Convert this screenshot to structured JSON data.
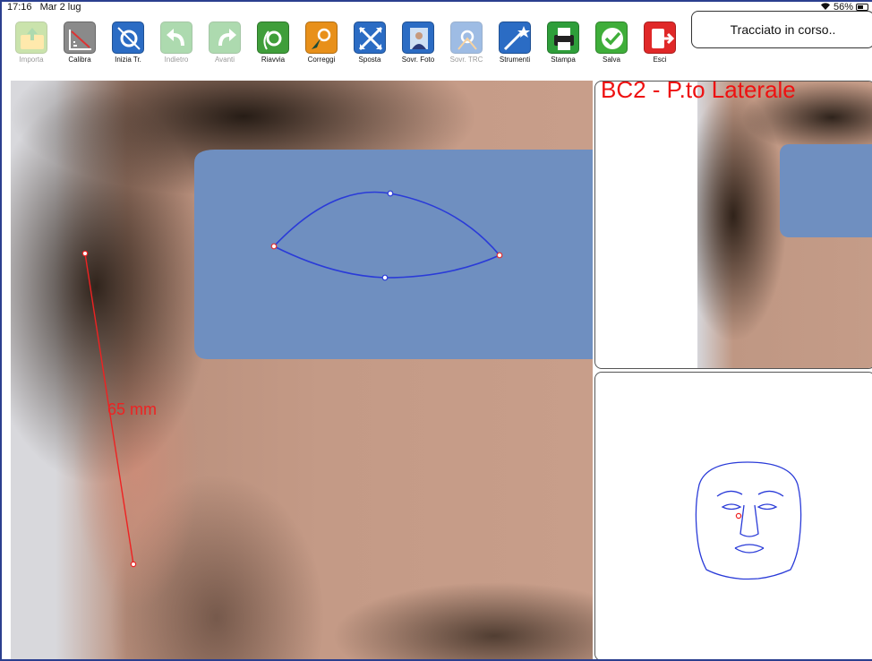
{
  "status_bar": {
    "time": "17:16",
    "date": "Mar 2 lug",
    "battery": "56%"
  },
  "toolbar": {
    "tools": [
      {
        "label": "Importa",
        "icon": "import-folder-icon",
        "color": "#8bc34a",
        "enabled": false
      },
      {
        "label": "Calibra",
        "icon": "calibrate-ruler-icon",
        "color": "#8a8a8a",
        "enabled": true
      },
      {
        "label": "Inizia Tr.",
        "icon": "start-tracing-icon",
        "color": "#2b6cc4",
        "enabled": true
      },
      {
        "label": "Indietro",
        "icon": "undo-icon",
        "color": "#4caf50",
        "enabled": false
      },
      {
        "label": "Avanti",
        "icon": "redo-icon",
        "color": "#4caf50",
        "enabled": false
      },
      {
        "label": "Riavvia",
        "icon": "restart-icon",
        "color": "#3f9e3a",
        "enabled": true
      },
      {
        "label": "Correggi",
        "icon": "correct-icon",
        "color": "#e8901a",
        "enabled": true
      },
      {
        "label": "Sposta",
        "icon": "move-arrows-icon",
        "color": "#2b6cc4",
        "enabled": true
      },
      {
        "label": "Sovr. Foto",
        "icon": "overlay-photo-icon",
        "color": "#2b6cc4",
        "enabled": true
      },
      {
        "label": "Sovr. TRC",
        "icon": "overlay-trc-icon",
        "color": "#2b6cc4",
        "enabled": false
      },
      {
        "label": "Strumenti",
        "icon": "tools-wand-icon",
        "color": "#2b6cc4",
        "enabled": true
      },
      {
        "label": "Stampa",
        "icon": "printer-icon",
        "color": "#2e9e3a",
        "enabled": true
      },
      {
        "label": "Salva",
        "icon": "save-check-icon",
        "color": "#3fae3a",
        "enabled": true
      },
      {
        "label": "Esci",
        "icon": "exit-icon",
        "color": "#e02828",
        "enabled": true
      }
    ],
    "status_text": "Tracciato in corso.."
  },
  "main": {
    "measurement_label": "65 mm"
  },
  "preview": {
    "title": "BC2 - P.to Laterale"
  },
  "colors": {
    "mask": "#6f8fc0",
    "trace": "#2a3bd8",
    "measure": "#ee2222",
    "title_red": "#ee1111"
  }
}
